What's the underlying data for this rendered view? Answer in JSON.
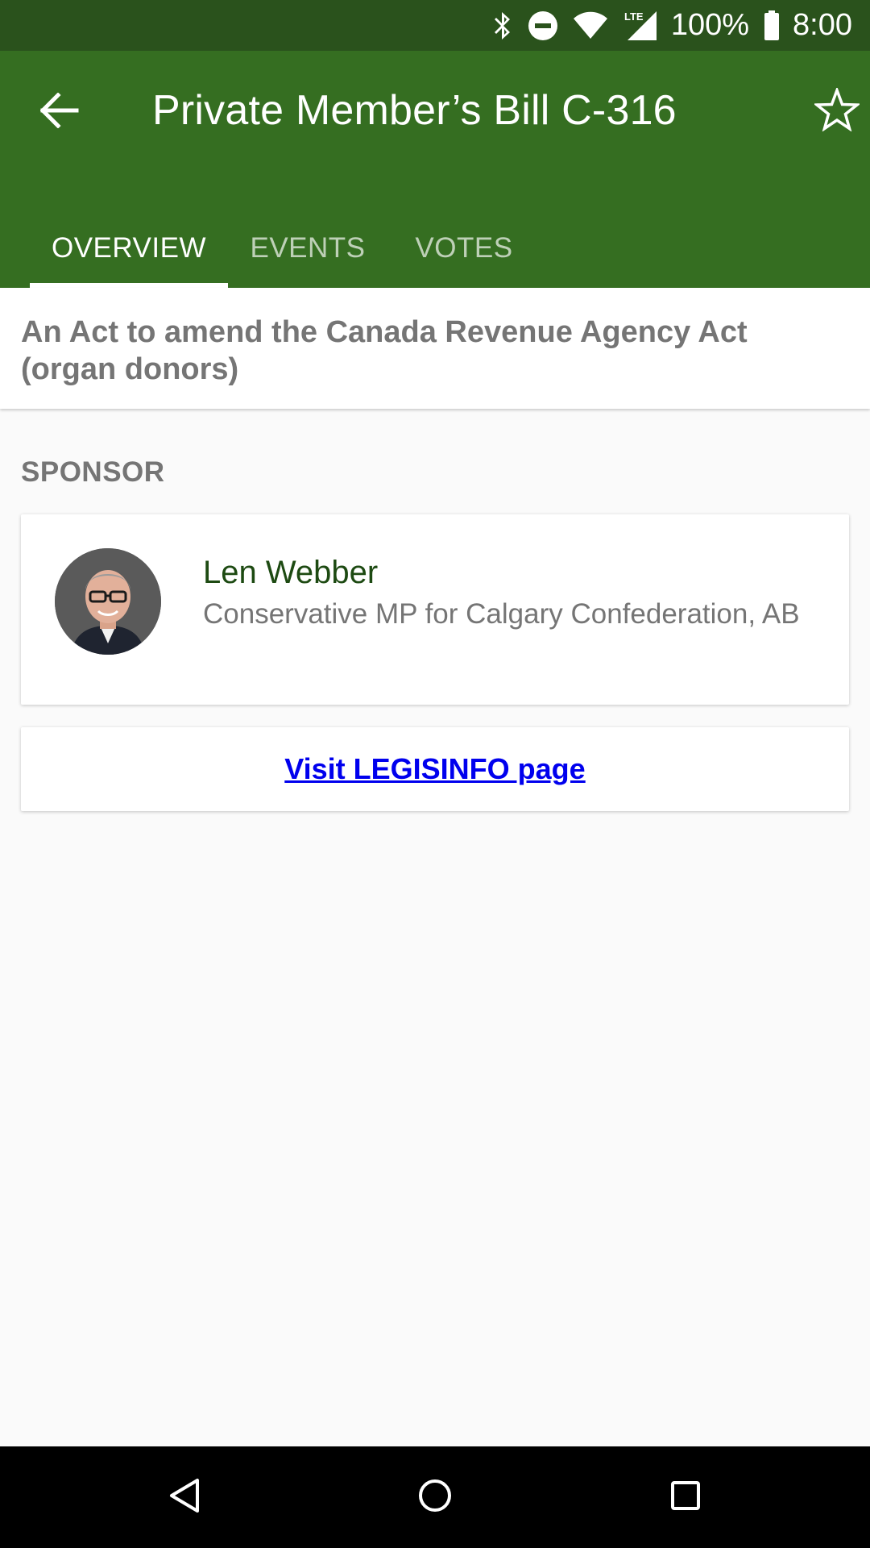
{
  "status_bar": {
    "battery": "100%",
    "time": "8:00",
    "icons": [
      "bluetooth-icon",
      "do-not-disturb-icon",
      "wifi-icon",
      "lte-signal-icon",
      "battery-icon"
    ]
  },
  "app_bar": {
    "title": "Private Member’s Bill C-316",
    "back_icon": "arrow-back-icon",
    "favorite_icon": "star-outline-icon",
    "colors": {
      "status_bar": "#2a521c",
      "toolbar": "#356e21"
    }
  },
  "tabs": [
    {
      "label": "OVERVIEW",
      "active": true
    },
    {
      "label": "EVENTS",
      "active": false
    },
    {
      "label": "VOTES",
      "active": false
    }
  ],
  "summary": {
    "text": "An Act to amend the Canada Revenue Agency Act (organ donors)"
  },
  "sponsor": {
    "section_label": "SPONSOR",
    "name": "Len Webber",
    "description": "Conservative MP for Calgary Confederation, AB",
    "name_color": "#1d4a12"
  },
  "link": {
    "label": "Visit LEGISINFO page",
    "color": "#0000ee"
  },
  "nav_bar": {
    "icons": [
      "nav-back-icon",
      "nav-home-icon",
      "nav-recents-icon"
    ]
  }
}
